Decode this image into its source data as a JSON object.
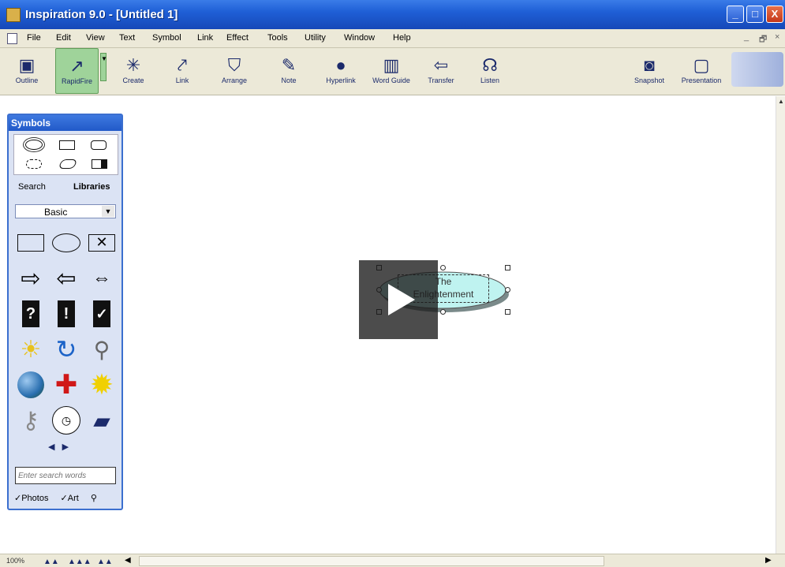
{
  "window": {
    "title": "Inspiration 9.0 - [Untitled 1]",
    "min": "_",
    "max": "□",
    "close": "X"
  },
  "menu": {
    "items": [
      "File",
      "Edit",
      "View",
      "Text",
      "Symbol",
      "Link",
      "Effect",
      "Tools",
      "Utility",
      "Window",
      "Help"
    ],
    "mdi_min": "_",
    "mdi_restore": "🗗",
    "mdi_close": "×"
  },
  "toolbar": {
    "outline": "Outline",
    "rapidfire": "RapidFire",
    "create": "Create",
    "link": "Link",
    "arrange": "Arrange",
    "note": "Note",
    "hyperlink": "Hyperlink",
    "wordguide": "Word Guide",
    "transfer": "Transfer",
    "listen": "Listen",
    "snapshot": "Snapshot",
    "presentation": "Presentation"
  },
  "symbols": {
    "title": "Symbols",
    "tabs": {
      "search": "Search",
      "libraries": "Libraries"
    },
    "library": "Basic",
    "search_placeholder": "Enter search words",
    "checks": {
      "photos": "Photos",
      "art": "Art"
    }
  },
  "canvas": {
    "node_text_1": "The",
    "node_text_2": "Enlightenment"
  },
  "status": {
    "zoom": "100%"
  },
  "colors": {
    "accent": "#2159c8",
    "active_tool": "#9fd39a",
    "node_fill": "#bff3f0"
  }
}
